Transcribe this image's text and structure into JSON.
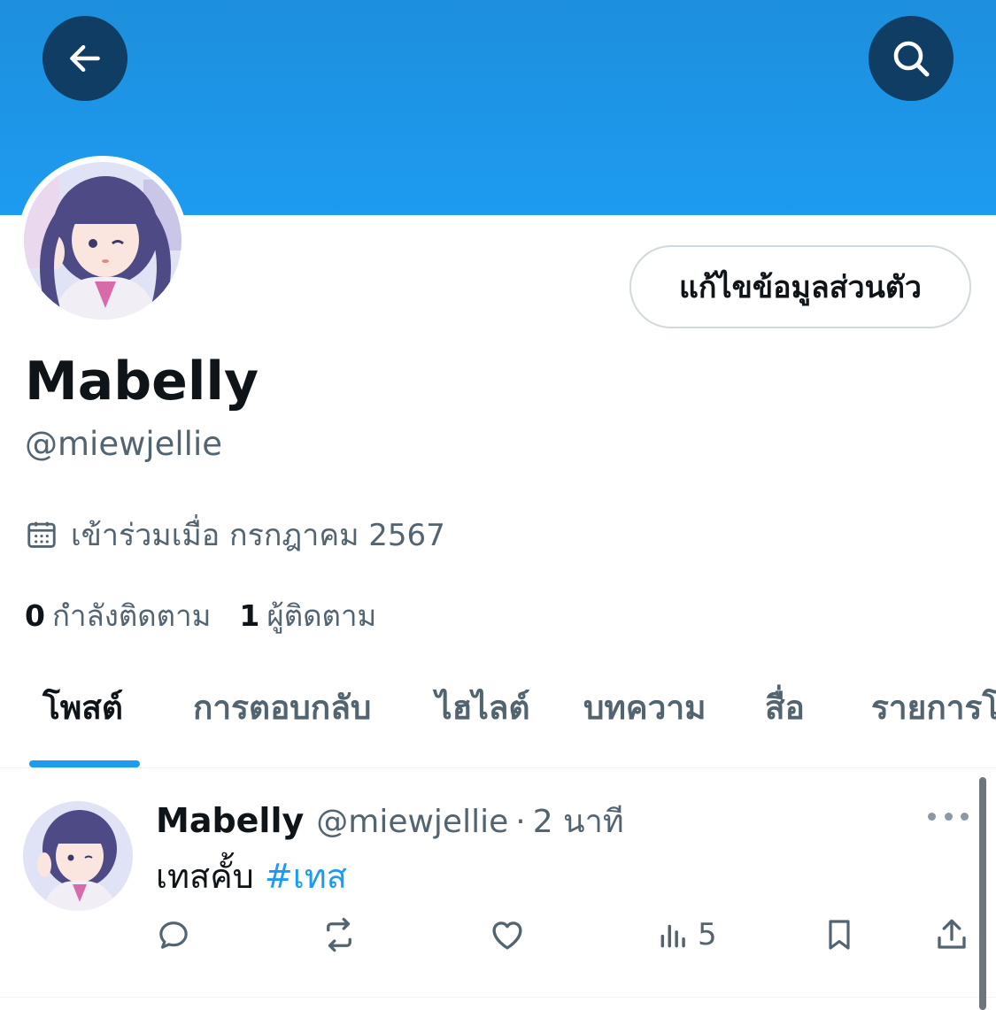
{
  "header": {
    "back_icon": "arrow-left-icon",
    "search_icon": "search-icon"
  },
  "profile": {
    "display_name": "Mabelly",
    "handle": "@miewjellie",
    "edit_button_label": "แก้ไขข้อมูลส่วนตัว",
    "joined_text": "เข้าร่วมเมื่อ กรกฎาคม 2567",
    "following_count": "0",
    "following_label": "กำลังติดตาม",
    "followers_count": "1",
    "followers_label": "ผู้ติดตาม"
  },
  "tabs": [
    {
      "label": "โพสต์",
      "active": true
    },
    {
      "label": "การตอบกลับ"
    },
    {
      "label": "ไฮไลต์"
    },
    {
      "label": "บทความ"
    },
    {
      "label": "สื่อ"
    },
    {
      "label": "รายการโปรด"
    }
  ],
  "post": {
    "author_name": "Mabelly",
    "author_handle": "@miewjellie",
    "separator": "·",
    "time": "2 นาที",
    "text": "เทสคั้บ",
    "hashtag": "#เทส",
    "views": "5"
  },
  "colors": {
    "banner": "#1d9bf0",
    "accent": "#1d9bf0",
    "text_primary": "#0f1419",
    "text_secondary": "#536471"
  }
}
